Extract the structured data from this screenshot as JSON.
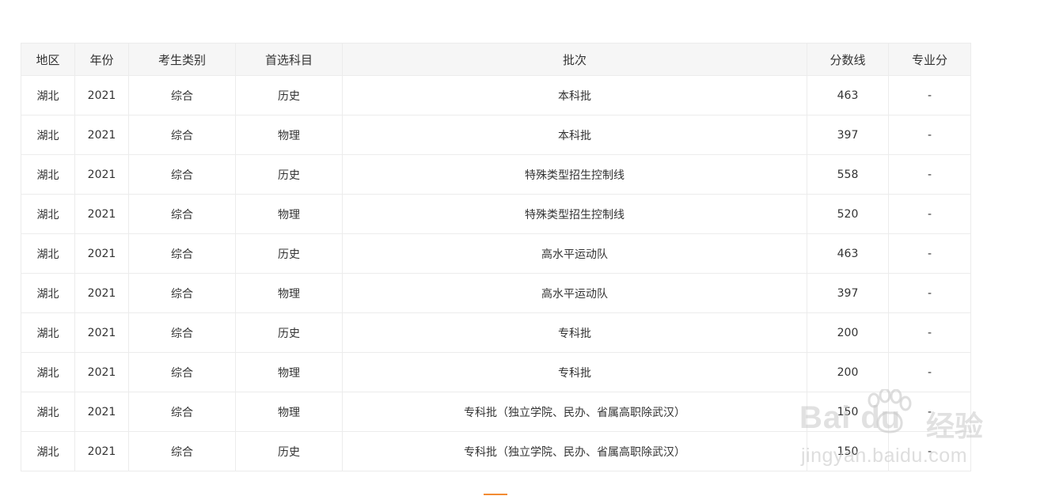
{
  "table": {
    "headers": [
      "地区",
      "年份",
      "考生类别",
      "首选科目",
      "批次",
      "分数线",
      "专业分"
    ],
    "rows": [
      [
        "湖北",
        "2021",
        "综合",
        "历史",
        "本科批",
        "463",
        "-"
      ],
      [
        "湖北",
        "2021",
        "综合",
        "物理",
        "本科批",
        "397",
        "-"
      ],
      [
        "湖北",
        "2021",
        "综合",
        "历史",
        "特殊类型招生控制线",
        "558",
        "-"
      ],
      [
        "湖北",
        "2021",
        "综合",
        "物理",
        "特殊类型招生控制线",
        "520",
        "-"
      ],
      [
        "湖北",
        "2021",
        "综合",
        "历史",
        "高水平运动队",
        "463",
        "-"
      ],
      [
        "湖北",
        "2021",
        "综合",
        "物理",
        "高水平运动队",
        "397",
        "-"
      ],
      [
        "湖北",
        "2021",
        "综合",
        "历史",
        "专科批",
        "200",
        "-"
      ],
      [
        "湖北",
        "2021",
        "综合",
        "物理",
        "专科批",
        "200",
        "-"
      ],
      [
        "湖北",
        "2021",
        "综合",
        "物理",
        "专科批（独立学院、民办、省属高职除武汉）",
        "150",
        "-"
      ],
      [
        "湖北",
        "2021",
        "综合",
        "历史",
        "专科批（独立学院、民办、省属高职除武汉）",
        "150",
        "-"
      ]
    ]
  },
  "watermark": {
    "logo_text": "Bai du",
    "cn_text": "经验",
    "url_text": "jingyan.baidu.com",
    "icon": "paw-icon"
  },
  "colors": {
    "header_bg": "#f6f6f6",
    "border": "#ececec",
    "accent": "#f28a30"
  }
}
